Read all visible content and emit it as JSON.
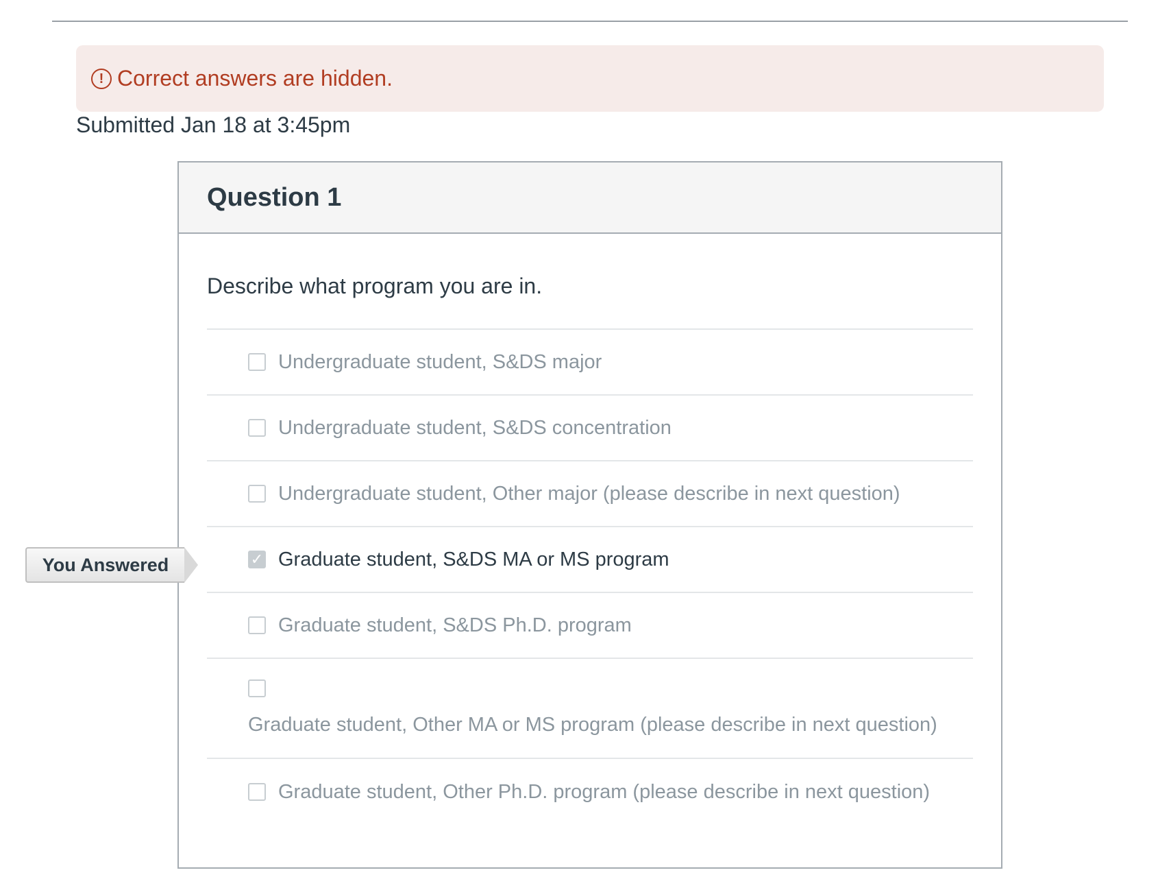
{
  "alert": {
    "icon": "exclamation-circle-icon",
    "icon_glyph": "!",
    "text": "Correct answers are hidden.",
    "color": "#b13d22",
    "background": "#f6ebe9"
  },
  "submitted_text": "Submitted Jan 18 at 3:45pm",
  "question": {
    "title": "Question 1",
    "prompt": "Describe what program you are in.",
    "you_answered_label": "You Answered",
    "answers": [
      {
        "label": "Undergraduate student, S&DS major",
        "checked": false
      },
      {
        "label": "Undergraduate student, S&DS concentration",
        "checked": false
      },
      {
        "label": "Undergraduate student, Other major (please describe in next question)",
        "checked": false
      },
      {
        "label": "Graduate student, S&DS MA or MS program",
        "checked": true,
        "check_glyph": "✓"
      },
      {
        "label": "Graduate student, S&DS Ph.D. program",
        "checked": false
      },
      {
        "label": "Graduate student, Other MA or MS program (please describe in next question)",
        "checked": false
      },
      {
        "label": "Graduate student, Other Ph.D. program (please describe in next question)",
        "checked": false
      }
    ]
  }
}
